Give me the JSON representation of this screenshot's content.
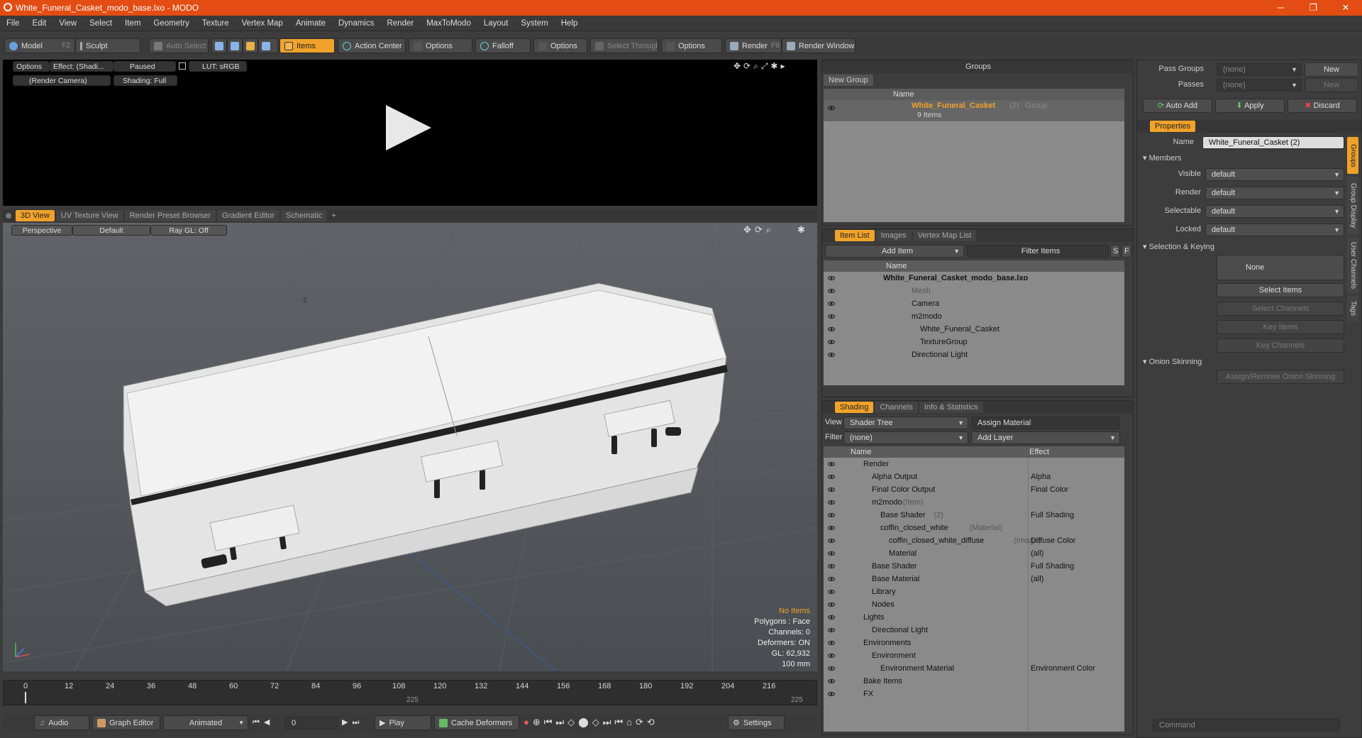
{
  "window": {
    "title": "White_Funeral_Casket_modo_base.lxo - MODO",
    "min": "─",
    "max": "❐",
    "close": "✕"
  },
  "menu": [
    "File",
    "Edit",
    "View",
    "Select",
    "Item",
    "Geometry",
    "Texture",
    "Vertex Map",
    "Animate",
    "Dynamics",
    "Render",
    "MaxToModo",
    "Layout",
    "System",
    "Help"
  ],
  "toolbar": {
    "model": "Model",
    "model_key": "F2",
    "sculpt": "Sculpt",
    "auto_select": "Auto Select",
    "items": "Items",
    "action_center": "Action Center",
    "options1": "Options",
    "falloff": "Falloff",
    "options2": "Options",
    "select_through": "Select Through",
    "options3": "Options",
    "render": "Render",
    "render_key": "F9",
    "render_window": "Render Window"
  },
  "preview": {
    "options": "Options",
    "effect": "Effect: (Shadi...",
    "paused": "Paused",
    "lut": "LUT: sRGB",
    "camera": "(Render Camera)",
    "shading": "Shading: Full"
  },
  "viewport": {
    "tabs": [
      "3D View",
      "UV Texture View",
      "Render Preset Browser",
      "Gradient Editor",
      "Schematic"
    ],
    "perspective": "Perspective",
    "default": "Default",
    "raygl": "Ray GL: Off",
    "axis_label": "-Z",
    "stats": {
      "no_items": "No Items",
      "polygons": "Polygons : Face",
      "channels": "Channels: 0",
      "deformers": "Deformers: ON",
      "gl": "GL: 62,932",
      "unit": "100 mm"
    }
  },
  "timeline": {
    "ticks": [
      "0",
      "12",
      "24",
      "36",
      "48",
      "60",
      "72",
      "84",
      "96",
      "108",
      "120",
      "132",
      "144",
      "156",
      "168",
      "180",
      "192",
      "204",
      "216"
    ],
    "sub_left": "225",
    "sub_right": "225"
  },
  "bottombar": {
    "audio": "Audio",
    "graph": "Graph Editor",
    "animated": "Animated",
    "frame": "0",
    "play": "Play",
    "cache": "Cache Deformers",
    "settings": "Settings"
  },
  "groups": {
    "title": "Groups",
    "new_group": "New Group",
    "col_name": "Name",
    "item_name": "White_Funeral_Casket",
    "item_suffix": "(2) : Group",
    "item_count": "9 Items"
  },
  "itemlist": {
    "tabs": [
      "Item List",
      "Images",
      "Vertex Map List"
    ],
    "add_item": "Add Item",
    "filter": "Filter Items",
    "s": "S",
    "f": "F",
    "col_name": "Name",
    "rows": [
      {
        "t": "White_Funeral_Casket_modo_base.lxo",
        "d": 0,
        "bold": true
      },
      {
        "t": "Mesh",
        "d": 2,
        "dim": true
      },
      {
        "t": "Camera",
        "d": 2
      },
      {
        "t": "m2modo",
        "d": 2
      },
      {
        "t": "White_Funeral_Casket",
        "d": 3
      },
      {
        "t": "TextureGroup",
        "d": 3
      },
      {
        "t": "Directional Light",
        "d": 2
      }
    ]
  },
  "shading": {
    "tabs": [
      "Shading",
      "Channels",
      "Info & Statistics"
    ],
    "view_label": "View",
    "view_value": "Shader Tree",
    "assign": "Assign Material",
    "filter_label": "Filter",
    "filter_value": "(none)",
    "add_layer": "Add Layer",
    "col_name": "Name",
    "col_effect": "Effect",
    "rows": [
      {
        "n": "Render",
        "x": "",
        "d": 0
      },
      {
        "n": "Alpha Output",
        "x": "Alpha",
        "d": 1
      },
      {
        "n": "Final Color Output",
        "x": "Final Color",
        "d": 1
      },
      {
        "n": "m2modo",
        "s": "(Item)",
        "x": "",
        "d": 1
      },
      {
        "n": "Base Shader",
        "s": "(2)",
        "x": "Full Shading",
        "d": 2
      },
      {
        "n": "coffin_closed_white",
        "s": "(Material)",
        "x": "",
        "d": 2
      },
      {
        "n": "coffin_closed_white_diffuse",
        "s": "(Image)",
        "x": "Diffuse Color",
        "d": 3
      },
      {
        "n": "Material",
        "x": "(all)",
        "d": 3
      },
      {
        "n": "Base Shader",
        "x": "Full Shading",
        "d": 1
      },
      {
        "n": "Base Material",
        "x": "(all)",
        "d": 1
      },
      {
        "n": "Library",
        "x": "",
        "d": 1
      },
      {
        "n": "Nodes",
        "x": "",
        "d": 1
      },
      {
        "n": "Lights",
        "x": "",
        "d": 0
      },
      {
        "n": "Directional Light",
        "x": "",
        "d": 1
      },
      {
        "n": "Environments",
        "x": "",
        "d": 0
      },
      {
        "n": "Environment",
        "x": "",
        "d": 1
      },
      {
        "n": "Environment Material",
        "x": "Environment Color",
        "d": 2
      },
      {
        "n": "Bake Items",
        "x": "",
        "d": 0
      },
      {
        "n": "FX",
        "x": "",
        "d": 0
      }
    ]
  },
  "props": {
    "pass_groups": "Pass Groups",
    "passes": "Passes",
    "none": "(none)",
    "new": "New",
    "auto_add": "Auto Add",
    "apply": "Apply",
    "discard": "Discard",
    "tab": "Properties",
    "name_label": "Name",
    "name_value": "White_Funeral_Casket (2)",
    "members": "Members",
    "visible": "Visible",
    "render": "Render",
    "selectable": "Selectable",
    "locked": "Locked",
    "default": "default",
    "sel_keying": "Selection & Keying",
    "none_btn": "None",
    "select_items": "Select Items",
    "select_channels": "Select Channels",
    "key_items": "Key Items",
    "key_channels": "Key Channels",
    "onion": "Onion Skinning",
    "assign_onion": "Assign/Remove Onion Skinning",
    "side_tabs": [
      "Groups",
      "Group Display",
      "User Channels",
      "Tags"
    ],
    "command": "Command"
  }
}
